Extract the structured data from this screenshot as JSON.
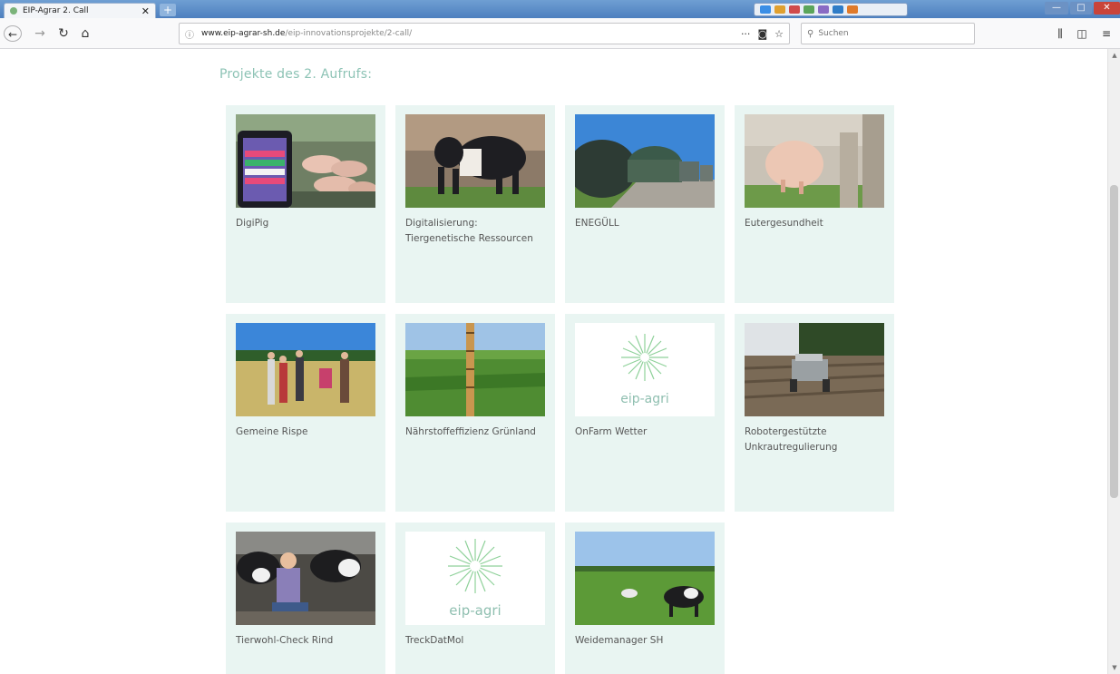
{
  "browser": {
    "tab_title": "EIP-Agrar 2. Call",
    "tab_close": "✕",
    "new_tab": "+",
    "url_host": "www.eip-agrar-sh.de",
    "url_path": "/eip-innovationsprojekte/2-call/",
    "search_placeholder": "Suchen"
  },
  "page": {
    "heading": "Projekte des 2. Aufrufs:"
  },
  "projects": [
    {
      "label": "DigiPig",
      "image": "pig-tablet-photo"
    },
    {
      "label": "Digitalisierung: Tiergenetische Ressourcen",
      "image": "black-white-pig-photo"
    },
    {
      "label": "ENEGÜLL",
      "image": "biogas-plant-photo"
    },
    {
      "label": "Eutergesundheit",
      "image": "cow-udder-photo"
    },
    {
      "label": "Gemeine Rispe",
      "image": "people-in-field-photo"
    },
    {
      "label": "Nährstoffeffizienz Grünland",
      "image": "grass-ruler-photo"
    },
    {
      "label": "OnFarm Wetter",
      "image": "eip-agri-logo"
    },
    {
      "label": "Robotergestützte Unkrautregulierung",
      "image": "field-robot-photo"
    },
    {
      "label": "Tierwohl-Check Rind",
      "image": "cattle-barn-photo"
    },
    {
      "label": "TreckDatMol",
      "image": "eip-agri-logo"
    },
    {
      "label": "Weidemanager SH",
      "image": "cows-pasture-photo"
    }
  ],
  "logo_text": "eip-agri",
  "colors": {
    "accent": "#8dc3b5",
    "card_bg": "#e9f5f2"
  }
}
